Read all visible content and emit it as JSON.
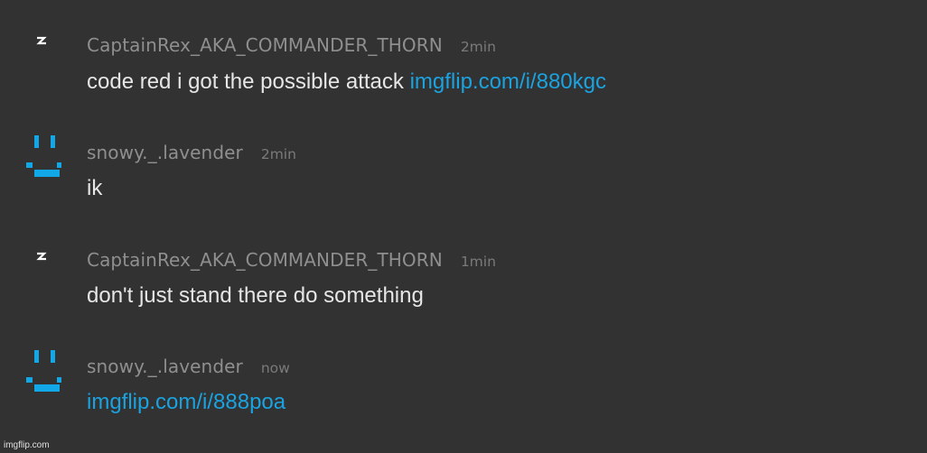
{
  "colors": {
    "background": "#323232",
    "username": "#8f8f8f",
    "timestamp": "#7a7a7a",
    "message_text": "#e6e6e6",
    "link": "#1aa3e0",
    "avatar_blue": "#12a8e8"
  },
  "messages": [
    {
      "avatar_icon": "lightning-bolt-icon",
      "username": "CaptainRex_AKA_COMMANDER_THORN",
      "timestamp": "2min",
      "text": "code red i got the possible attack",
      "link": "imgflip.com/i/880kgc"
    },
    {
      "avatar_icon": "smiley-face-icon",
      "username": "snowy._.lavender",
      "timestamp": "2min",
      "text": "ik",
      "link": ""
    },
    {
      "avatar_icon": "lightning-bolt-icon",
      "username": "CaptainRex_AKA_COMMANDER_THORN",
      "timestamp": "1min",
      "text": "don't just stand there do something",
      "link": ""
    },
    {
      "avatar_icon": "smiley-face-icon",
      "username": "snowy._.lavender",
      "timestamp": "now",
      "text": "",
      "link": "imgflip.com/i/888poa"
    }
  ],
  "watermark": "imgflip.com"
}
